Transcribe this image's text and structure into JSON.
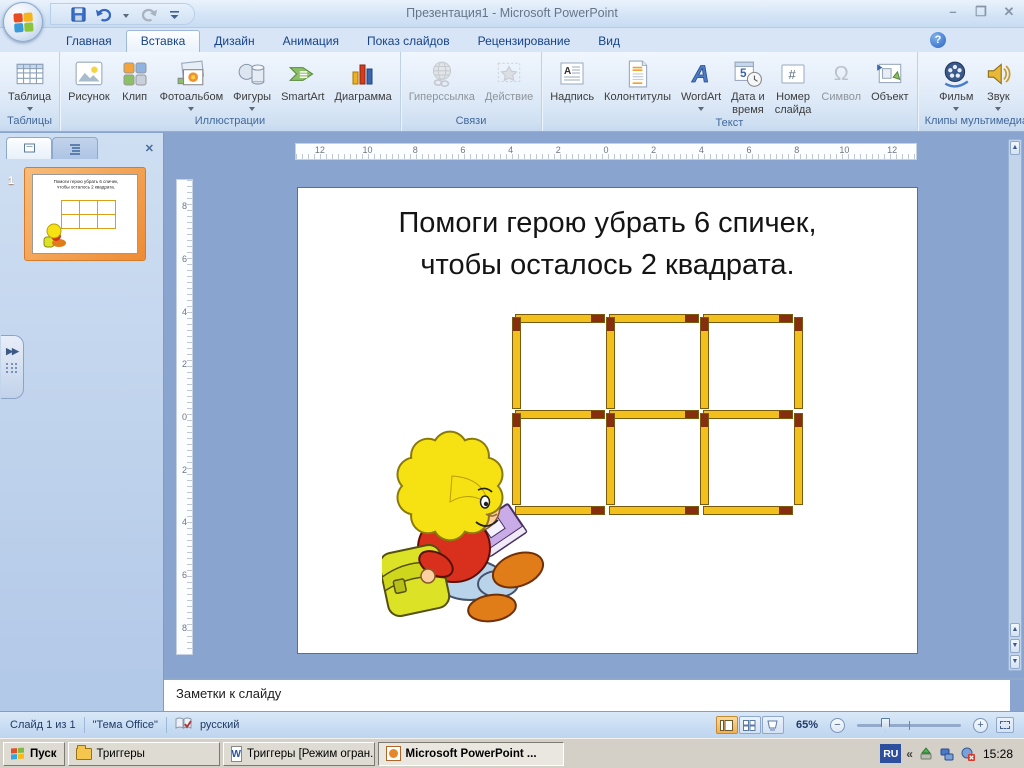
{
  "window": {
    "title": "Презентация1 - Microsoft PowerPoint"
  },
  "ribbon": {
    "active_tab": "Вставка",
    "tabs": [
      {
        "label": "Главная"
      },
      {
        "label": "Вставка"
      },
      {
        "label": "Дизайн"
      },
      {
        "label": "Анимация"
      },
      {
        "label": "Показ слайдов"
      },
      {
        "label": "Рецензирование"
      },
      {
        "label": "Вид"
      }
    ],
    "groups": [
      {
        "label": "Таблицы",
        "buttons": [
          {
            "label": "Таблица",
            "dropdown": true
          }
        ]
      },
      {
        "label": "Иллюстрации",
        "buttons": [
          {
            "label": "Рисунок"
          },
          {
            "label": "Клип"
          },
          {
            "label": "Фотоальбом",
            "dropdown": true
          },
          {
            "label": "Фигуры",
            "dropdown": true
          },
          {
            "label": "SmartArt"
          },
          {
            "label": "Диаграмма"
          }
        ]
      },
      {
        "label": "Связи",
        "buttons": [
          {
            "label": "Гиперссылка",
            "disabled": true
          },
          {
            "label": "Действие",
            "disabled": true
          }
        ]
      },
      {
        "label": "Текст",
        "buttons": [
          {
            "label": "Надпись"
          },
          {
            "label": "Колонтитулы"
          },
          {
            "label": "WordArt",
            "dropdown": true
          },
          {
            "label": "Дата и",
            "label2": "время"
          },
          {
            "label": "Номер",
            "label2": "слайда"
          },
          {
            "label": "Символ",
            "disabled": true
          },
          {
            "label": "Объект"
          }
        ]
      },
      {
        "label": "Клипы мультимедиа",
        "buttons": [
          {
            "label": "Фильм",
            "dropdown": true
          },
          {
            "label": "Звук",
            "dropdown": true
          }
        ]
      }
    ]
  },
  "slide_panel": {
    "slide_number": "1"
  },
  "rulers": {
    "horizontal": [
      "12",
      "10",
      "8",
      "6",
      "4",
      "2",
      "0",
      "2",
      "4",
      "6",
      "8",
      "10",
      "12"
    ],
    "vertical": [
      "8",
      "6",
      "4",
      "2",
      "0",
      "2",
      "4",
      "6",
      "8"
    ]
  },
  "slide": {
    "title_line1": "Помоги герою убрать 6 спичек,",
    "title_line2": "чтобы осталось 2 квадрата.",
    "puzzle": {
      "type": "matchstick-grid",
      "rows": 2,
      "cols": 3,
      "match_count": 17
    }
  },
  "notes": {
    "placeholder": "Заметки к слайду"
  },
  "status_bar": {
    "slide_info": "Слайд 1 из 1",
    "theme": "\"Тема Office\"",
    "language": "русский",
    "zoom_level": "65%"
  },
  "taskbar": {
    "start_label": "Пуск",
    "tasks": [
      {
        "label": "Триггеры"
      },
      {
        "label": "Триггеры [Режим огран..."
      },
      {
        "label": "Microsoft PowerPoint ...",
        "active": true
      }
    ],
    "tray": {
      "language_indicator": "RU",
      "collapse": "«",
      "time": "15:28"
    }
  },
  "colors": {
    "selection_orange": "#ee8b33",
    "match_body": "#f2c01d",
    "match_head": "#872e11",
    "workspace_blue": "#89a4cf",
    "taskbar_gray": "#d4d0c8"
  }
}
